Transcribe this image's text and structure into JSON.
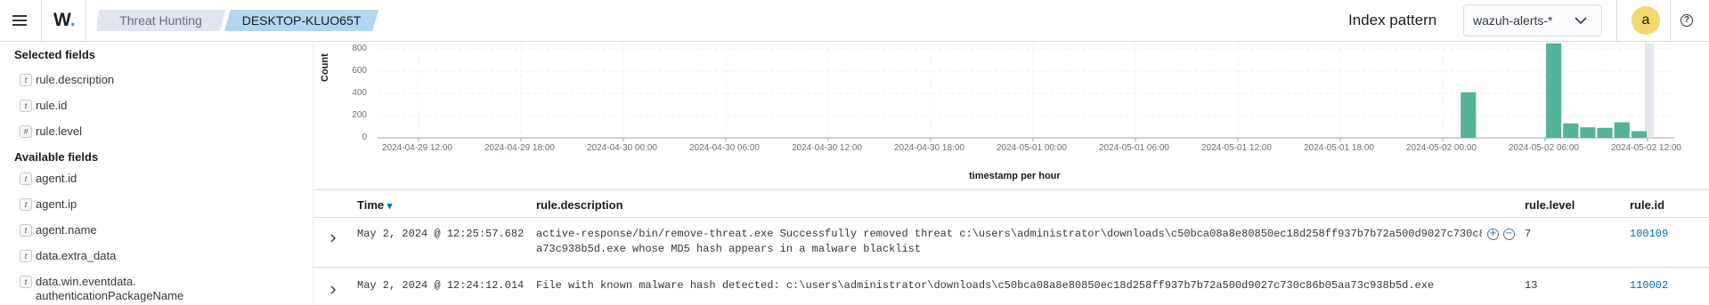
{
  "header": {
    "logo_text": "W",
    "logo_dot": ".",
    "breadcrumbs": [
      "Threat Hunting",
      "DESKTOP-KLUO65T"
    ],
    "index_pattern_label": "Index pattern",
    "index_pattern_value": "wazuh-alerts-*",
    "avatar_letter": "a",
    "help_symbol": "?"
  },
  "sidebar": {
    "selected_heading": "Selected fields",
    "selected_fields": [
      {
        "type": "t",
        "name": "rule.description"
      },
      {
        "type": "t",
        "name": "rule.id"
      },
      {
        "type": "#",
        "name": "rule.level"
      }
    ],
    "available_heading": "Available fields",
    "available_fields": [
      {
        "type": "t",
        "name": "agent.id"
      },
      {
        "type": "t",
        "name": "agent.ip"
      },
      {
        "type": "t",
        "name": "agent.name"
      },
      {
        "type": "t",
        "name": "data.extra_data"
      },
      {
        "type": "t",
        "name": "data.win.eventdata.",
        "name2": "authenticationPackageName"
      }
    ]
  },
  "chart_data": {
    "type": "bar",
    "xlabel": "timestamp per hour",
    "ylabel": "Count",
    "ylim": [
      0,
      850
    ],
    "y_ticks": [
      "800",
      "600",
      "400",
      "200",
      "0"
    ],
    "x_ticks": [
      "2024-04-29 12:00",
      "2024-04-29 18:00",
      "2024-04-30 00:00",
      "2024-04-30 06:00",
      "2024-04-30 12:00",
      "2024-04-30 18:00",
      "2024-05-01 00:00",
      "2024-05-01 06:00",
      "2024-05-01 12:00",
      "2024-05-01 18:00",
      "2024-05-02 00:00",
      "2024-05-02 06:00",
      "2024-05-02 12:00"
    ],
    "bar_color": "#54b399",
    "bars": [
      {
        "x": "2024-05-02 01:00",
        "value": 410
      },
      {
        "x": "2024-05-02 06:00",
        "value": 850
      },
      {
        "x": "2024-05-02 07:00",
        "value": 130
      },
      {
        "x": "2024-05-02 08:00",
        "value": 95
      },
      {
        "x": "2024-05-02 09:00",
        "value": 90
      },
      {
        "x": "2024-05-02 10:00",
        "value": 140
      },
      {
        "x": "2024-05-02 11:00",
        "value": 60
      }
    ],
    "grid": true
  },
  "table": {
    "columns": {
      "time": "Time",
      "sort_arrow": "▾",
      "description": "rule.description",
      "level": "rule.level",
      "id": "rule.id"
    },
    "rows": [
      {
        "time": "May 2, 2024 @ 12:25:57.682",
        "description_line1": "active-response/bin/remove-threat.exe Successfully removed threat c:\\users\\administrator\\downloads\\c50bca08a8e80850ec18d258ff937b7b72a500d9027c730c86",
        "description_line2": "a73c938b5d.exe whose MD5 hash appears in a malware blacklist",
        "level": "7",
        "id": "100109"
      },
      {
        "time": "May 2, 2024 @ 12:24:12.014",
        "description_line1": "File with known malware hash detected: c:\\users\\administrator\\downloads\\c50bca08a8e80850ec18d258ff937b7b72a500d9027c730c86b05aa73c938b5d.exe",
        "description_line2": "",
        "level": "13",
        "id": "110002"
      }
    ],
    "filter_plus": "+",
    "filter_minus": "−"
  }
}
